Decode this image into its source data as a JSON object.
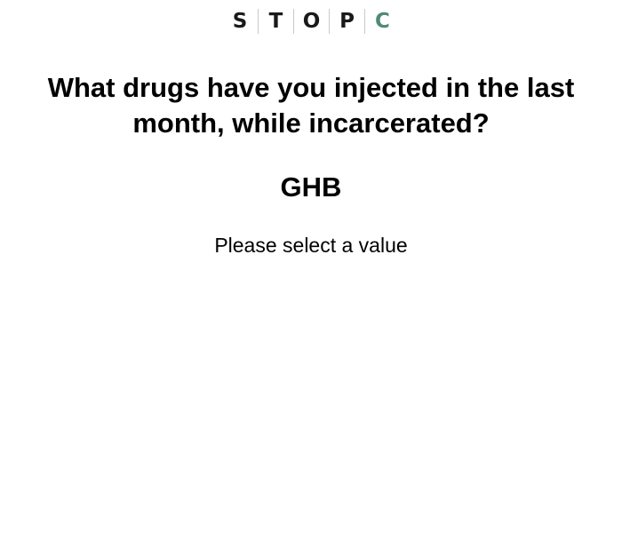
{
  "logo": {
    "letters": [
      "S",
      "T",
      "O",
      "P",
      "C"
    ],
    "accent_color": "#4f8a78"
  },
  "question": {
    "text": "What drugs have you injected in the last month, while incarcerated?"
  },
  "item": {
    "label": "GHB"
  },
  "prompt": {
    "text": "Please select a value"
  }
}
